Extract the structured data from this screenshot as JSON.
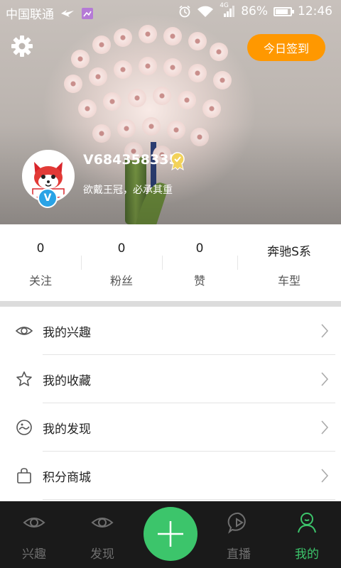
{
  "status_bar": {
    "carrier": "中国联通",
    "network": "4G",
    "battery": "86%",
    "battery_level": 0.86,
    "time": "12:46"
  },
  "header": {
    "settings_icon": "gear-icon",
    "checkin_label": "今日签到"
  },
  "profile": {
    "username": "V684358335",
    "motto": "欲戴王冠，必承其重",
    "verified_mark": "V",
    "avatar_text": "记录"
  },
  "stats": [
    {
      "value": "0",
      "label": "关注"
    },
    {
      "value": "0",
      "label": "粉丝"
    },
    {
      "value": "0",
      "label": "赞"
    },
    {
      "value": "奔驰S系",
      "label": "车型"
    }
  ],
  "menu": [
    {
      "label": "我的兴趣",
      "icon": "eye-icon"
    },
    {
      "label": "我的收藏",
      "icon": "star-icon"
    },
    {
      "label": "我的发现",
      "icon": "discover-icon"
    },
    {
      "label": "积分商城",
      "icon": "shopping-bag-icon"
    }
  ],
  "tabs": [
    {
      "label": "兴趣",
      "icon": "eye-icon",
      "active": false
    },
    {
      "label": "发现",
      "icon": "eye-icon",
      "active": false
    },
    {
      "label": "直播",
      "icon": "live-chat-icon",
      "active": false
    },
    {
      "label": "我的",
      "icon": "person-icon",
      "active": true
    }
  ],
  "colors": {
    "accent_orange": "#ff9800",
    "accent_green": "#3cc56b",
    "tabbar_bg": "#1a1a1a",
    "verified_blue": "#2aa3e6"
  }
}
